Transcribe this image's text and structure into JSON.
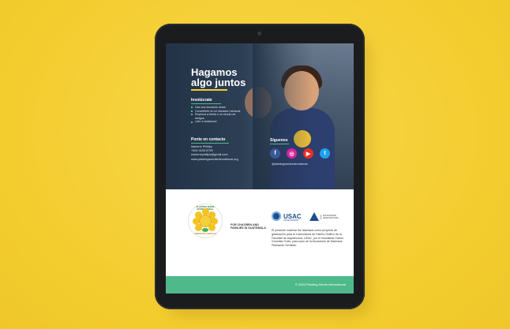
{
  "hero": {
    "title_line1": "Hagamos",
    "title_line2": "algo juntos"
  },
  "involucrate": {
    "heading": "Involúcrate",
    "items": [
      "Haz una donación única.",
      "Conviértete en un donador mensual.",
      "Empieza a bieda o un círculo de amigos.",
      "¡Ven a visitarnos!"
    ]
  },
  "contacto": {
    "heading": "Ponte en contacto",
    "name": "Marlene Phillips",
    "phone": "+502 4153 8799",
    "email": "marlenephillips@gmail.com",
    "web": "www.plantingseedsinternational.org"
  },
  "siguenos": {
    "heading": "Síguenos",
    "icons": [
      {
        "name": "facebook-icon",
        "glyph": "f",
        "color": "#3b5998"
      },
      {
        "name": "instagram-icon",
        "glyph": "◎",
        "color": "#d6249f"
      },
      {
        "name": "youtube-icon",
        "glyph": "▶",
        "color": "#e52d27"
      },
      {
        "name": "twitter-icon",
        "glyph": "t",
        "color": "#1da1f2"
      }
    ],
    "handle": "@plantingseedsinternational"
  },
  "logos": {
    "org_ring_top": "PLANTING SEEDS INTERNATIONAL",
    "org_ring_bottom": "SEMBRANDO SEMILLAS",
    "children_line1": "FOR CHILDREN AND",
    "children_line2": "FAMILIES IN GUATEMALA",
    "usac": "USAC",
    "usac_sub": "TRICENTENARIA",
    "farq_line1": "FACULTAD DE",
    "farq_line2": "ARQUITECTURA"
  },
  "description": "El presente material fue diseñado como proyecto de graduación para la Licenciatura de Diseño Gráfico de la Facultad de Arquitectura, USAC, por el estudiante Carlos González Solís, para usos de la Asociación de Maestros Plantando Semillas.",
  "footer": "© 2020 Planting Seeds International"
}
